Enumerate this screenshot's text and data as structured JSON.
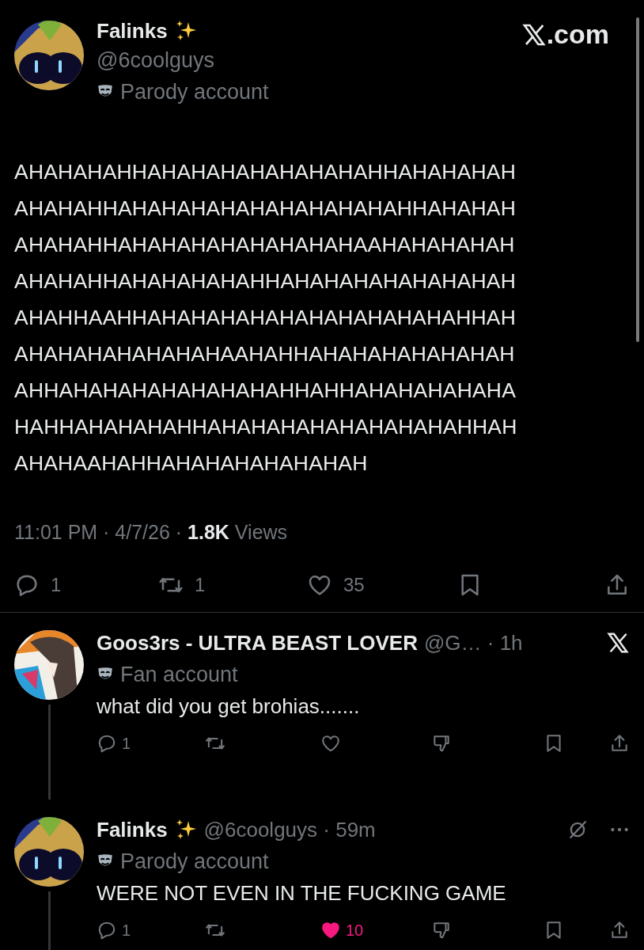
{
  "main_post": {
    "author": {
      "name": "Falinks",
      "handle": "@6coolguys",
      "label": "Parody account"
    },
    "site": ".com",
    "body_lines": [
      "AHAHAHAHHAHAHAHAHAHAHAHAHHAHAHAHAH",
      "AHAHAHHAHAHAHAHAHAHAHAHAHAHHAHAHAH",
      "AHAHAHHAHAHAHAHAHAHAHAHAAHAHAHAHAH",
      "AHAHAHHAHAHAHAHAHHAHAHAHAHAHAHAHAH",
      "AHAHHAAHHAHAHAHAHAHAHAHAHAHAHAHHAH",
      "AHAHAHAHAHAHAHAAHAHHAHAHAHAHAHAHAH",
      "AHHAHAHAHAHAHAHAHAHHAHHAHAHAHAHAHA",
      "HAHHAHAHAHAHHAHAHAHAHAHAHAHAHAHHAH",
      "AHAHAAHAHHAHAHAHAHAHAHAH"
    ],
    "meta": "11:01 PM · 4/7/26 · **1.8K** Views",
    "actions": [
      {
        "kind": "reply",
        "count": "1",
        "active": false
      },
      {
        "kind": "repost",
        "count": "1",
        "active": false
      },
      {
        "kind": "like",
        "count": "35",
        "active": false
      },
      {
        "kind": "bookmark",
        "active": false
      },
      {
        "kind": "share",
        "active": false
      }
    ]
  },
  "replies": [
    {
      "name": "Goos3rs - ULTRA BEAST LOVER",
      "meta": "@G… · 1h",
      "label": "Fan account",
      "text": "what did you get brohias.......",
      "sparkles": false,
      "x_logo": true,
      "actions": [
        {
          "kind": "reply",
          "count": "1",
          "active": false
        },
        {
          "kind": "repost",
          "active": false
        },
        {
          "kind": "like",
          "active": false
        },
        {
          "kind": "downvote",
          "active": false
        },
        {
          "kind": "bookmark",
          "active": false
        },
        {
          "kind": "share",
          "active": false
        }
      ]
    },
    {
      "name": "Falinks",
      "meta": "@6coolguys · 59m",
      "label": "Parody account",
      "text": "WERE NOT EVEN IN THE FUCKING GAME",
      "sparkles": true,
      "x_logo": false,
      "actions": [
        {
          "kind": "reply",
          "count": "1",
          "active": false
        },
        {
          "kind": "repost",
          "active": false
        },
        {
          "kind": "like",
          "count": "10",
          "active": true
        },
        {
          "kind": "downvote",
          "active": false
        },
        {
          "kind": "bookmark",
          "active": false
        },
        {
          "kind": "share",
          "active": false
        }
      ]
    }
  ]
}
